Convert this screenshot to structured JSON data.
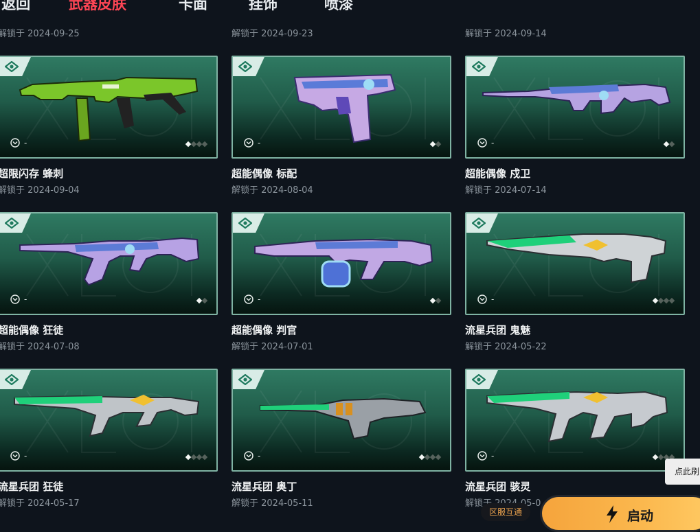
{
  "nav": {
    "back_label": "返回",
    "tabs": [
      "武器皮肤",
      "卡面",
      "挂饰",
      "喷漆"
    ]
  },
  "top_dates": [
    "解锁于 2024-09-25",
    "解锁于 2024-09-23",
    "解锁于 2024-09-14"
  ],
  "skins": [
    {
      "name": "超限闪存 蜂刺",
      "date": "解锁于 2024-09-04",
      "equip": "-",
      "variants": 4,
      "gun": "smg-green",
      "accent": "#7bc62a"
    },
    {
      "name": "超能偶像 标配",
      "date": "解锁于 2024-08-04",
      "equip": "-",
      "variants": 2,
      "gun": "pistol",
      "accent": "#a78fd8"
    },
    {
      "name": "超能偶像 戍卫",
      "date": "解锁于 2024-07-14",
      "equip": "-",
      "variants": 2,
      "gun": "rifle-long",
      "accent": "#a78fd8"
    },
    {
      "name": "超能偶像 狂徒",
      "date": "解锁于 2024-07-08",
      "equip": "-",
      "variants": 2,
      "gun": "rifle-ak",
      "accent": "#a78fd8"
    },
    {
      "name": "超能偶像 判官",
      "date": "解锁于 2024-07-01",
      "equip": "-",
      "variants": 2,
      "gun": "shotgun",
      "accent": "#a78fd8"
    },
    {
      "name": "流星兵团 鬼魅",
      "date": "解锁于 2024-05-22",
      "equip": "-",
      "variants": 4,
      "gun": "pistol-ghost",
      "accent": "#1fd07a"
    },
    {
      "name": "流星兵团 狂徒",
      "date": "解锁于 2024-05-17",
      "equip": "-",
      "variants": 4,
      "gun": "rifle-ak-green",
      "accent": "#1fd07a"
    },
    {
      "name": "流星兵团 奥丁",
      "date": "解锁于 2024-05-11",
      "equip": "-",
      "variants": 4,
      "gun": "lmg",
      "accent": "#1fd07a"
    },
    {
      "name": "流星兵团 骇灵",
      "date": "解锁于 2024-05-0",
      "equip": "-",
      "variants": 4,
      "gun": "smg-green2",
      "accent": "#1fd07a"
    }
  ],
  "cross_region_label": "区服互通",
  "launch_label": "启动",
  "hint_label": "点此刷",
  "colors": {
    "accent": "#ff4655",
    "launch": "#f5a43c",
    "card_border": "#7fb3a3"
  }
}
